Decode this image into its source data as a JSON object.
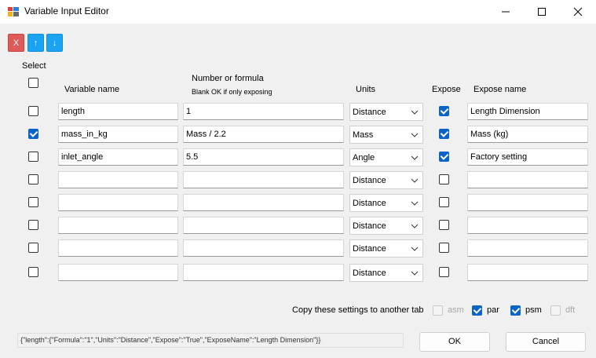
{
  "window": {
    "title": "Variable Input Editor",
    "controls": [
      "minimize-icon",
      "maximize-icon",
      "close-icon"
    ]
  },
  "toolbar": {
    "delete_label": "X",
    "up_label": "↑",
    "down_label": "↓",
    "colors": {
      "delete": "#e05a5a",
      "move": "#1aa3f0"
    }
  },
  "headers": {
    "select": "Select",
    "variable_name": "Variable name",
    "number_line1": "Number or formula",
    "number_line2": "Blank OK if only exposing",
    "units": "Units",
    "expose": "Expose",
    "expose_name": "Expose name"
  },
  "select_all_checked": false,
  "rows": [
    {
      "selected": false,
      "name": "length",
      "formula": "1",
      "units": "Distance",
      "expose": true,
      "expose_name": "Length Dimension"
    },
    {
      "selected": true,
      "name": "mass_in_kg",
      "formula": "Mass / 2.2",
      "units": "Mass",
      "expose": true,
      "expose_name": "Mass (kg)"
    },
    {
      "selected": false,
      "name": "inlet_angle",
      "formula": "5.5",
      "units": "Angle",
      "expose": true,
      "expose_name": "Factory setting"
    },
    {
      "selected": false,
      "name": "",
      "formula": "",
      "units": "Distance",
      "expose": false,
      "expose_name": ""
    },
    {
      "selected": false,
      "name": "",
      "formula": "",
      "units": "Distance",
      "expose": false,
      "expose_name": ""
    },
    {
      "selected": false,
      "name": "",
      "formula": "",
      "units": "Distance",
      "expose": false,
      "expose_name": ""
    },
    {
      "selected": false,
      "name": "",
      "formula": "",
      "units": "Distance",
      "expose": false,
      "expose_name": ""
    },
    {
      "selected": false,
      "name": "",
      "formula": "",
      "units": "Distance",
      "expose": false,
      "expose_name": ""
    }
  ],
  "copy": {
    "label": "Copy these settings to another tab",
    "options": [
      {
        "label": "asm",
        "checked": false,
        "enabled": false
      },
      {
        "label": "par",
        "checked": true,
        "enabled": true
      },
      {
        "label": "psm",
        "checked": true,
        "enabled": true
      },
      {
        "label": "dft",
        "checked": false,
        "enabled": false
      }
    ]
  },
  "status_text": "{\"length\":{\"Formula\":\"1\",\"Units\":\"Distance\",\"Expose\":\"True\",\"ExposeName\":\"Length Dimension\"}}",
  "buttons": {
    "ok": "OK",
    "cancel": "Cancel"
  }
}
